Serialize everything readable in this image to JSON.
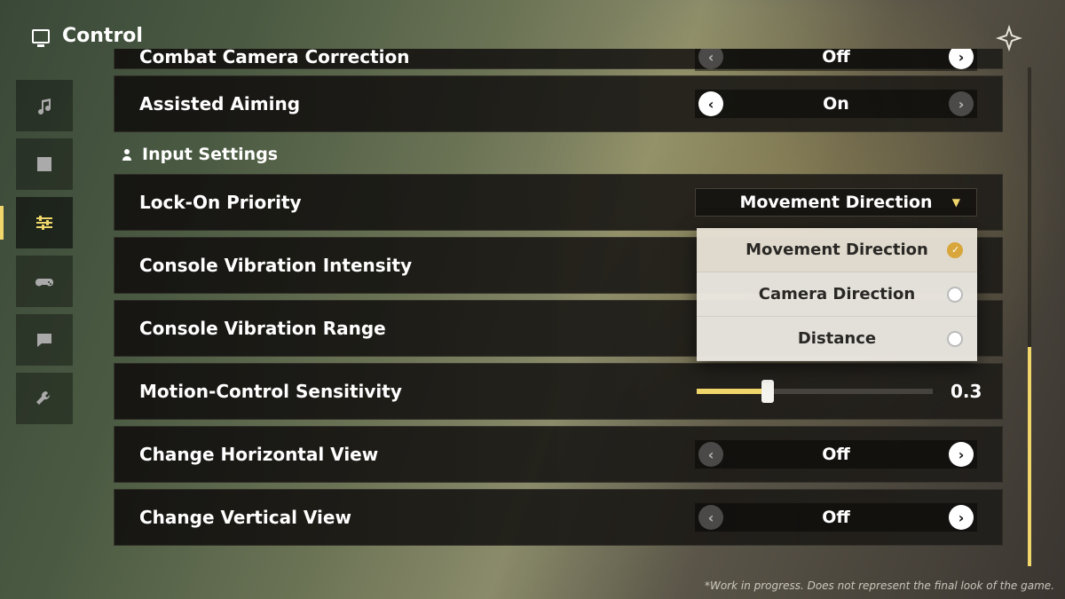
{
  "header": {
    "title": "Control"
  },
  "sidebar": {
    "active_index": 2
  },
  "section": {
    "input_settings": "Input Settings"
  },
  "rows": {
    "combat_camera": {
      "label": "Combat Camera Correction",
      "value": "Off"
    },
    "assisted_aiming": {
      "label": "Assisted Aiming",
      "value": "On"
    },
    "lock_on": {
      "label": "Lock-On Priority",
      "value": "Movement Direction"
    },
    "vib_intensity": {
      "label": "Console Vibration Intensity"
    },
    "vib_range": {
      "label": "Console Vibration Range"
    },
    "motion_sens": {
      "label": "Motion-Control Sensitivity",
      "value": "0.3",
      "fraction": 0.3
    },
    "change_h": {
      "label": "Change Horizontal View",
      "value": "Off"
    },
    "change_v": {
      "label": "Change Vertical View",
      "value": "Off"
    }
  },
  "dropdown_options": {
    "opt1": "Movement Direction",
    "opt2": "Camera Direction",
    "opt3": "Distance"
  },
  "footer": "*Work in progress. Does not represent the final look of the game.",
  "scrollbar": {
    "thumb_top_pct": 56,
    "thumb_height_pct": 44
  }
}
